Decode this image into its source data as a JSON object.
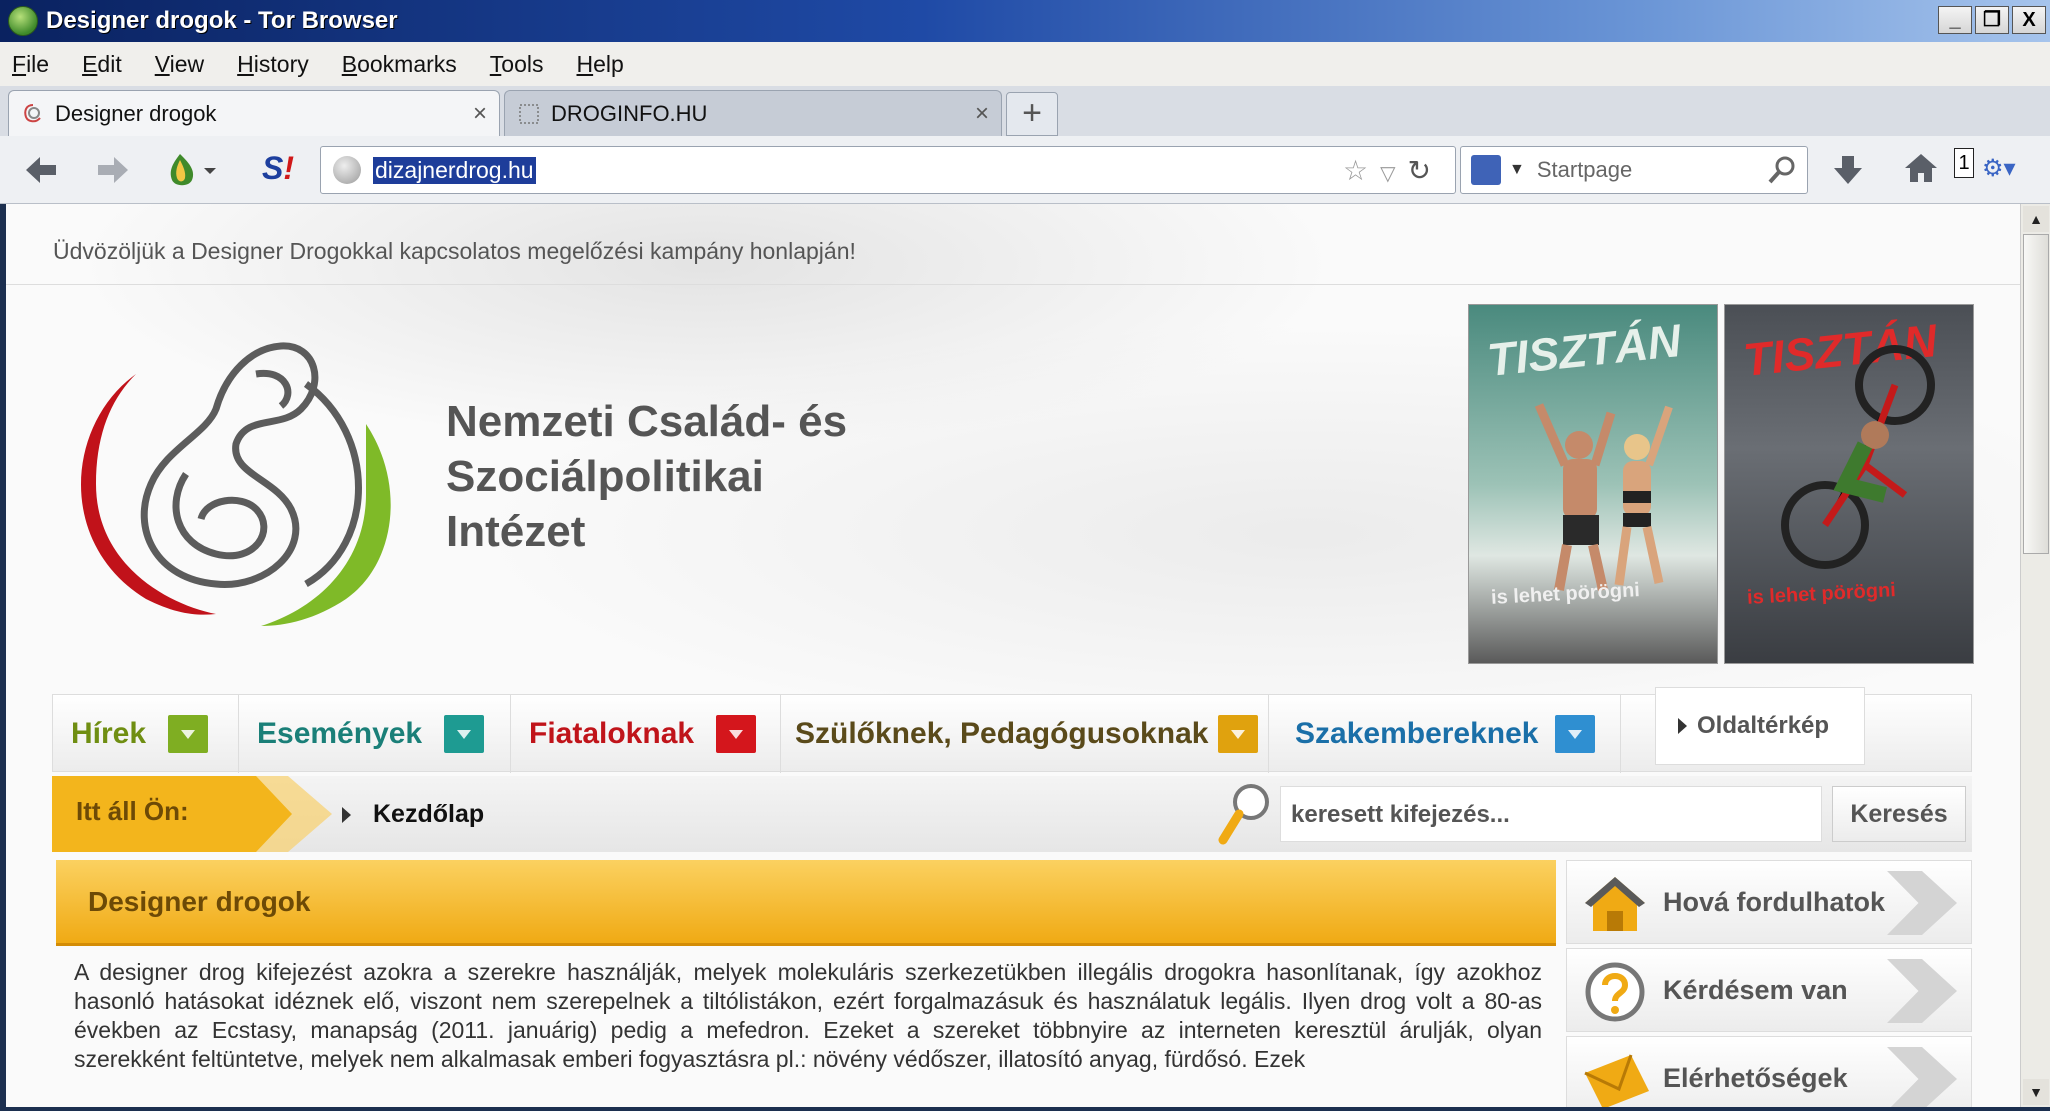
{
  "window": {
    "title": "Designer drogok - Tor Browser",
    "controls": {
      "minimize": "_",
      "restore": "❐",
      "close": "X"
    }
  },
  "menu": [
    "File",
    "Edit",
    "View",
    "History",
    "Bookmarks",
    "Tools",
    "Help"
  ],
  "tabs": [
    {
      "label": "Designer drogok",
      "close": "×",
      "active": true
    },
    {
      "label": "DROGINFO.HU",
      "close": "×",
      "active": false
    }
  ],
  "newtab_label": "+",
  "navbar": {
    "url": "dizajnerdrog.hu",
    "search_placeholder": "Startpage",
    "counter": "1"
  },
  "page": {
    "welcome": "Üdvözöljük a Designer Drogokkal kapcsolatos megelőzési kampány honlapján!",
    "institute_lines": [
      "Nemzeti Család- és",
      "Szociálpolitikai",
      "Intézet"
    ],
    "posters": [
      {
        "title": "TISZTÁN",
        "subtitle": "is lehet pörögni"
      },
      {
        "title": "TISZTÁN",
        "subtitle": "is lehet pörögni"
      }
    ],
    "nav": [
      {
        "label": "Hírek",
        "color": "#6f8e12",
        "chev": "#7fae22"
      },
      {
        "label": "Események",
        "color": "#1a7f78",
        "chev": "#1e9b92"
      },
      {
        "label": "Fiataloknak",
        "color": "#c0141a",
        "chev": "#d4161c"
      },
      {
        "label": "Szülőknek, Pedagógusoknak",
        "color": "#5a4a1a",
        "chev": "#e0a20e"
      },
      {
        "label": "Szakembereknek",
        "color": "#1a6fa8",
        "chev": "#2f8fd1"
      }
    ],
    "sitemap": "Oldaltérkép",
    "you_are_here": "Itt áll Ön:",
    "breadcrumb": "Kezdőlap",
    "search_placeholder": "keresett kifejezés...",
    "search_button": "Keresés",
    "content_title": "Designer drogok",
    "content_text": "A designer drog kifejezést azokra a szerekre használják, melyek molekuláris szerkezetükben illegális drogokra hasonlítanak, így azokhoz hasonló hatásokat idéznek elő, viszont nem szerepelnek a tiltólistákon, ezért forgalmazásuk és használatuk legális. Ilyen drog volt a 80-as években az Ecstasy, manapság (2011. januárig) pedig a mefedron. Ezeket a szereket többnyire az interneten keresztül árulják, olyan szerekként feltüntetve, melyek nem alkalmasak emberi fogyasztásra pl.: növény védőszer, illatosító anyag, fürdősó. Ezek",
    "side_links": [
      {
        "label": "Hová fordulhatok",
        "icon": "home-icon"
      },
      {
        "label": "Kérdésem van",
        "icon": "question-icon"
      },
      {
        "label": "Elérhetőségek",
        "icon": "envelope-icon"
      }
    ]
  }
}
